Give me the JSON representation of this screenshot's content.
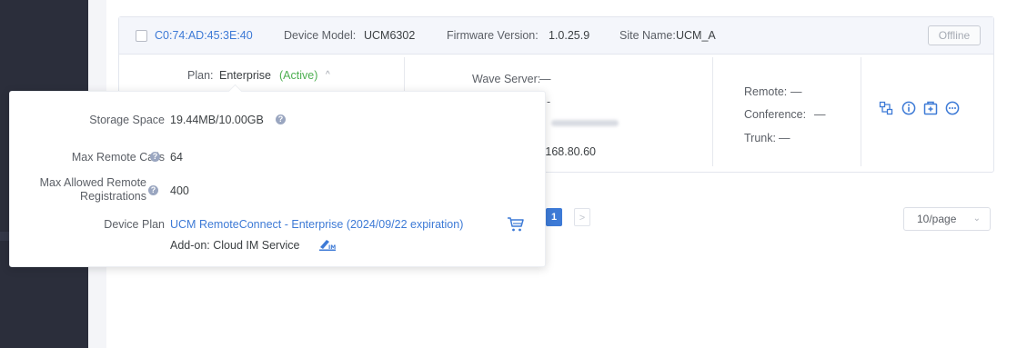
{
  "device": {
    "mac": "C0:74:AD:45:3E:40",
    "model_label": "Device Model:",
    "model": "UCM6302",
    "firmware_label": "Firmware Version:",
    "firmware": "1.0.25.9",
    "site_label": "Site Name:",
    "site": "UCM_A",
    "status": "Offline"
  },
  "plan": {
    "label": "Plan:",
    "name": "Enterprise",
    "state": "(Active)",
    "chevron": "^"
  },
  "server": {
    "wave_label": "Wave Server:",
    "wave_value": "—",
    "dash": "-",
    "ip_partial": "92.168.80.60"
  },
  "services": {
    "remote_label": "Remote:",
    "remote_value": "—",
    "conference_label": "Conference:",
    "conference_value": "—",
    "trunk_label": "Trunk:",
    "trunk_value": "—"
  },
  "actions": [
    "transfer-icon",
    "info-icon",
    "add-plan-icon",
    "more-icon"
  ],
  "popover": {
    "storage_label": "Storage Space",
    "storage_value": "19.44MB/10.00GB",
    "max_calls_label": "Max Remote Calls",
    "max_calls_value": "64",
    "max_reg_label_1": "Max Allowed Remote",
    "max_reg_label_2": "Registrations",
    "max_reg_value": "400",
    "plan_label": "Device Plan",
    "plan_value": "UCM RemoteConnect - Enterprise (2024/09/22 expiration)",
    "addon_value": "Add-on: Cloud IM Service",
    "help_glyph": "?"
  },
  "pagination": {
    "current": "1",
    "next": ">",
    "per_page": "10/page"
  },
  "colors": {
    "accent": "#3d7ad6",
    "active": "#4caf50",
    "sidebar": "#2b2e3b"
  }
}
